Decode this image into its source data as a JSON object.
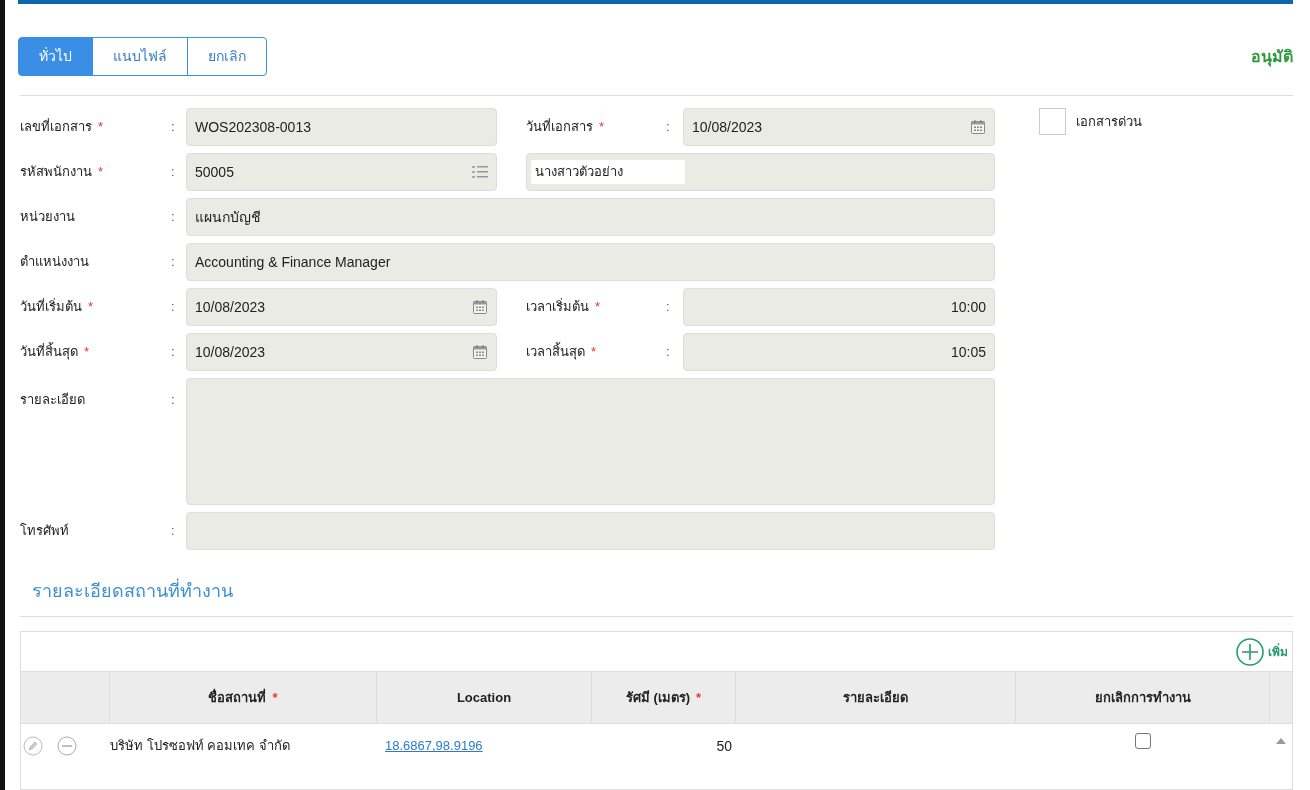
{
  "tabs": [
    {
      "label": "ทั่วไป",
      "selected": true
    },
    {
      "label": "แนบไฟล์",
      "selected": false
    },
    {
      "label": "ยกเลิก",
      "selected": false
    }
  ],
  "approve_label": "อนุมัติ",
  "form": {
    "urgent": {
      "label": "เอกสารด่วน",
      "checked": false
    },
    "rows": [
      {
        "kind": "pair",
        "left": {
          "label": "เลขที่เอกสาร",
          "required_mark": "*",
          "colon": ":",
          "kind": "text",
          "value": "WOS202308-0013"
        },
        "right": {
          "label": "วันที่เอกสาร",
          "required_mark": "*",
          "colon": ":",
          "kind": "date",
          "value": "10/08/2023"
        }
      },
      {
        "kind": "name",
        "left": {
          "label": "รหัสพนักงาน",
          "required_mark": "*",
          "colon": ":",
          "kind": "lookup",
          "value": "50005"
        },
        "right": {
          "value": "นางสาวตัวอย่าง"
        }
      },
      {
        "kind": "full",
        "left": {
          "label": "หน่วยงาน",
          "colon": ":",
          "kind": "text",
          "value": "แผนกบัญชี"
        }
      },
      {
        "kind": "full",
        "left": {
          "label": "ตำแหน่งงาน",
          "colon": ":",
          "kind": "text",
          "value": "Accounting & Finance Manager"
        }
      },
      {
        "kind": "pair",
        "left": {
          "label": "วันที่เริ่มต้น",
          "required_mark": "*",
          "colon": ":",
          "kind": "date",
          "value": "10/08/2023"
        },
        "right": {
          "label": "เวลาเริ่มต้น",
          "required_mark": "*",
          "colon": ":",
          "kind": "time",
          "value": "10:00"
        }
      },
      {
        "kind": "pair",
        "left": {
          "label": "วันที่สิ้นสุด",
          "required_mark": "*",
          "colon": ":",
          "kind": "date",
          "value": "10/08/2023"
        },
        "right": {
          "label": "เวลาสิ้นสุด",
          "required_mark": "*",
          "colon": ":",
          "kind": "time",
          "value": "10:05"
        }
      },
      {
        "kind": "textarea",
        "left": {
          "label": "รายละเอียด",
          "colon": ":",
          "kind": "text"
        }
      },
      {
        "kind": "full",
        "left": {
          "label": "โทรศัพท์",
          "colon": ":",
          "kind": "text"
        }
      }
    ]
  },
  "section_title": "รายละเอียดสถานที่ทำงาน",
  "table": {
    "add_label": "เพิ่ม",
    "columns": [
      {
        "label": "ชื่อสถานที่",
        "required_mark": "*"
      },
      {
        "label": "Location"
      },
      {
        "label": "รัศมี (เมตร)",
        "required_mark": "*"
      },
      {
        "label": "รายละเอียด"
      },
      {
        "label": "ยกเลิกการทำงาน"
      }
    ],
    "rows": [
      {
        "name": "บริษัท โปรซอฟท์ คอมเทค จำกัด",
        "location": "18.6867,98.9196",
        "radius": "50",
        "cancelled": false
      }
    ]
  }
}
